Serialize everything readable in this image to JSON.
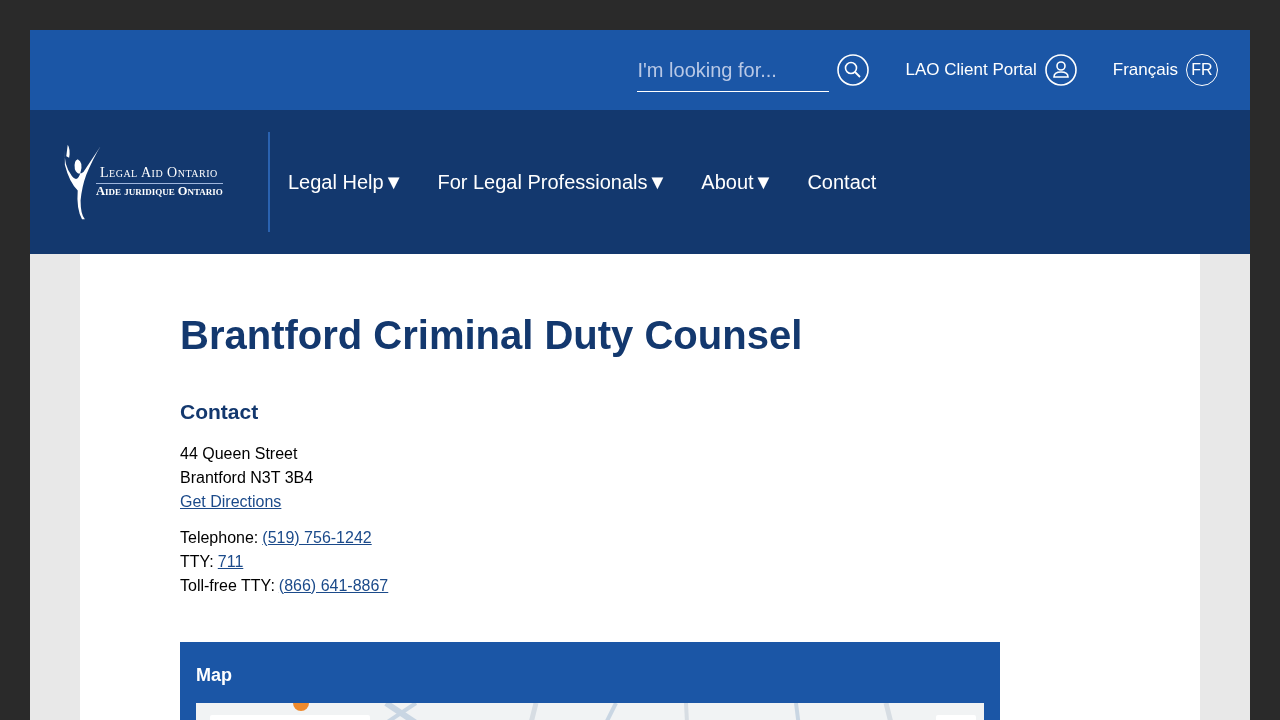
{
  "top_bar": {
    "search": {
      "placeholder": "I'm looking for..."
    },
    "portal_link": "LAO Client Portal",
    "language_link": "Français",
    "language_badge": "FR"
  },
  "logo": {
    "line_1": "Legal Aid Ontario",
    "line_2": "Aide juridique Ontario"
  },
  "nav": [
    {
      "label": "Legal Help",
      "has_menu": true
    },
    {
      "label": "For Legal Professionals",
      "has_menu": true
    },
    {
      "label": "About",
      "has_menu": true
    },
    {
      "label": "Contact",
      "has_menu": false
    }
  ],
  "menu_arrow": "▼",
  "page": {
    "title": "Brantford Criminal Duty Counsel",
    "contact_heading": "Contact",
    "address": [
      "44 Queen Street",
      "Brantford N3T 3B4"
    ],
    "directions_link": "Get Directions",
    "phones": [
      {
        "label": "Telephone:",
        "number": "(519) 756-1242"
      },
      {
        "label": "TTY:",
        "number": "711"
      },
      {
        "label": "Toll-free TTY:",
        "number": "(866) 641-8867"
      }
    ],
    "map": {
      "heading": "Map"
    }
  }
}
